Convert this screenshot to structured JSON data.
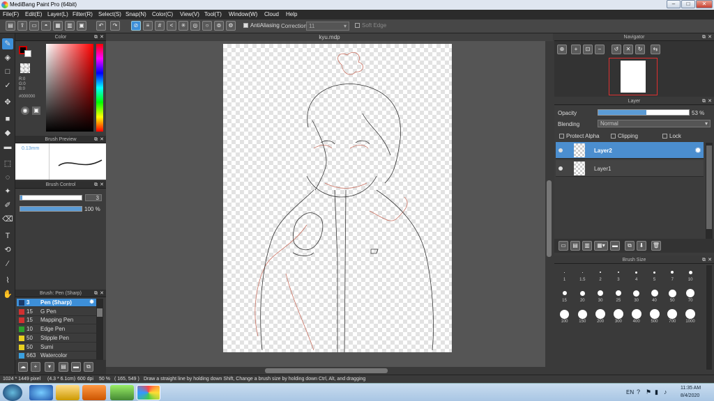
{
  "titlebar": {
    "title": "MediBang Paint Pro (64bit)",
    "min": "–",
    "max": "□",
    "close": "✕"
  },
  "menu": [
    "File(F)",
    "Edit(E)",
    "Layer(L)",
    "Filter(R)",
    "Select(S)",
    "Snap(N)",
    "Color(C)",
    "View(V)",
    "Tool(T)",
    "Window(W)",
    "Cloud",
    "Help"
  ],
  "toolbar": {
    "antialias_label": "AntiAliasing",
    "correction_label": "Correction",
    "correction_value": "11",
    "soft_edge_label": "Soft Edge"
  },
  "color_panel": {
    "title": "Color",
    "r": "R:0",
    "g": "G:0",
    "b": "B:0",
    "hex": "#000000",
    "fg": "#000000",
    "bg": "#ffffff"
  },
  "brush_preview": {
    "title": "Brush Preview",
    "size": "0.13mm"
  },
  "brush_control": {
    "title": "Brush Control",
    "size_value": "3",
    "size_fraction": 0.03,
    "opacity_value": "100 %",
    "opacity_fraction": 1.0
  },
  "brush_list": {
    "title": "Brush: Pen (Sharp)",
    "items": [
      {
        "size": "3",
        "name": "Pen (Sharp)",
        "color": "#1a3a6a"
      },
      {
        "size": "15",
        "name": "G Pen",
        "color": "#d03030"
      },
      {
        "size": "15",
        "name": "Mapping Pen",
        "color": "#d03030"
      },
      {
        "size": "10",
        "name": "Edge Pen",
        "color": "#2ca02c"
      },
      {
        "size": "50",
        "name": "Stipple Pen",
        "color": "#e8d020"
      },
      {
        "size": "50",
        "name": "Sumi",
        "color": "#e8d020"
      },
      {
        "size": "663",
        "name": "Watercolor",
        "color": "#3aa0e0"
      }
    ]
  },
  "document": {
    "tab": "kyu.mdp"
  },
  "navigator": {
    "title": "Navigator"
  },
  "layer_panel": {
    "title": "Layer",
    "opacity_label": "Opacity",
    "opacity_value": "53 %",
    "opacity_fraction": 0.53,
    "blending_label": "Blending",
    "blending_value": "Normal",
    "protect_alpha": "Protect Alpha",
    "clipping": "Clipping",
    "lock": "Lock",
    "layers": [
      {
        "name": "Layer2",
        "selected": true
      },
      {
        "name": "Layer1",
        "selected": false
      }
    ]
  },
  "brush_size": {
    "title": "Brush Size",
    "sizes": [
      "1",
      "1.5",
      "2",
      "3",
      "4",
      "5",
      "7",
      "10",
      "15",
      "20",
      "30",
      "25",
      "30",
      "40",
      "50",
      "70",
      "100",
      "150",
      "200",
      "300",
      "400",
      "500",
      "700",
      "1000"
    ]
  },
  "status": {
    "dims": "1024 * 1449 pixel",
    "cm": "(4.3 * 6.1cm)",
    "dpi": "600 dpi",
    "zoom": "50 %",
    "coord": "( 165, 549 )",
    "hint": "Draw a straight line by holding down Shift, Change a brush size by holding down Ctrl, Alt, and dragging"
  },
  "taskbar": {
    "lang": "EN",
    "time": "11:35 AM",
    "date": "8/4/2020"
  }
}
